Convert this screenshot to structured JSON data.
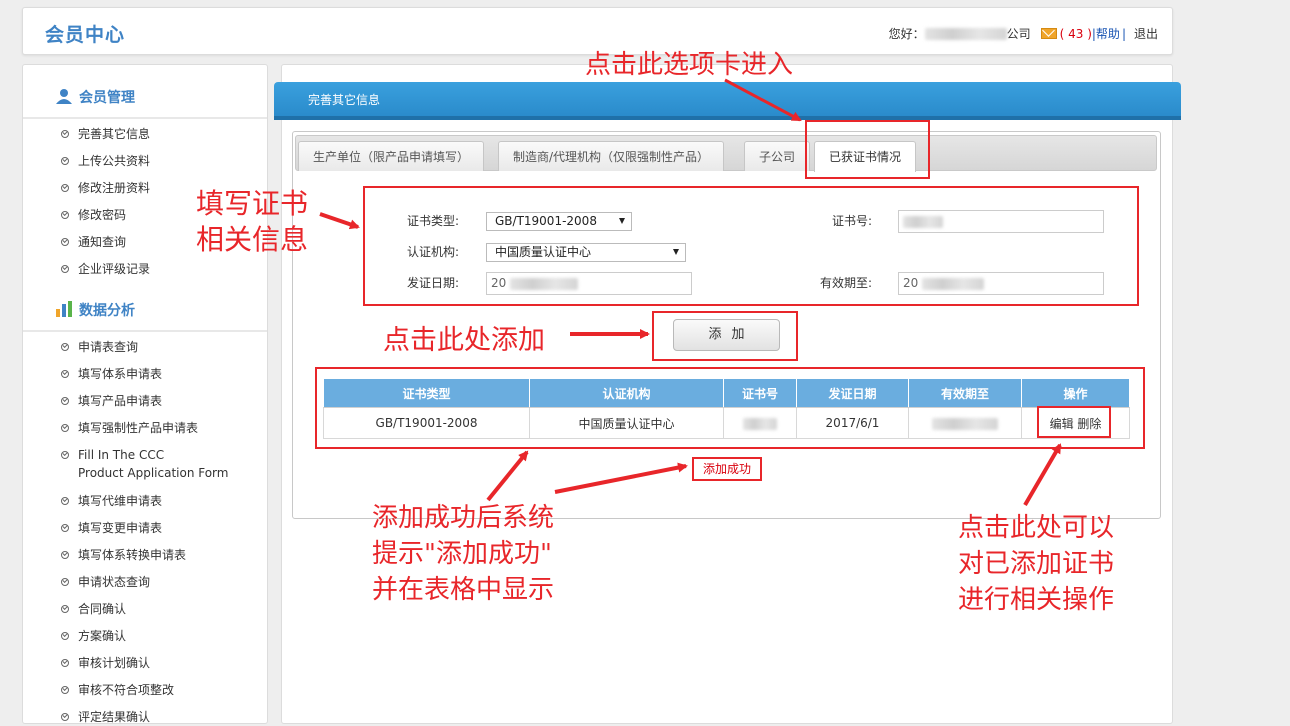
{
  "header": {
    "logo": "会员中心",
    "greeting": "您好：",
    "company_suffix": "公司",
    "mail_count": "( 43 )",
    "separator": "|",
    "help": "帮助",
    "logout": "退出"
  },
  "sidebar": {
    "section1": {
      "title": "会员管理",
      "items": [
        "完善其它信息",
        "上传公共资料",
        "修改注册资料",
        "修改密码",
        "通知查询",
        "企业评级记录"
      ]
    },
    "section2": {
      "title": "数据分析",
      "items": [
        "申请表查询",
        "填写体系申请表",
        "填写产品申请表",
        "填写强制性产品申请表",
        "Fill In The CCC",
        "Product Application Form",
        "填写代维申请表",
        "填写变更申请表",
        "填写体系转换申请表",
        "申请状态查询",
        "合同确认",
        "方案确认",
        "审核计划确认",
        "审核不符合项整改",
        "评定结果确认"
      ]
    }
  },
  "panel": {
    "title": "完善其它信息",
    "tabs": [
      "生产单位（限产品申请填写）",
      "制造商/代理机构（仅限强制性产品）",
      "子公司",
      "已获证书情况"
    ]
  },
  "form": {
    "cert_type_label": "证书类型:",
    "cert_type_value": "GB/T19001-2008",
    "cert_no_label": "证书号:",
    "agency_label": "认证机构:",
    "agency_value": "中国质量认证中心",
    "issue_date_label": "发证日期:",
    "issue_date_value": "20",
    "expiry_label": "有效期至:",
    "expiry_value": "20",
    "add_button": "添加"
  },
  "table": {
    "headers": [
      "证书类型",
      "认证机构",
      "证书号",
      "发证日期",
      "有效期至",
      "操作"
    ],
    "rows": [
      {
        "cert_type": "GB/T19001-2008",
        "agency": "中国质量认证中心",
        "issue_date": "2017/6/1",
        "edit": "编辑",
        "delete": "删除"
      }
    ]
  },
  "success_message": "添加成功",
  "annotations": {
    "tab_hint": "点击此选项卡进入",
    "fill_hint_1": "填写证书",
    "fill_hint_2": "相关信息",
    "add_hint": "点击此处添加",
    "success_hint_1": "添加成功后系统",
    "success_hint_2": "提示\"添加成功\"",
    "success_hint_3": "并在表格中显示",
    "op_hint_1": "点击此处可以",
    "op_hint_2": "对已添加证书",
    "op_hint_3": "进行相关操作"
  },
  "colors": {
    "brand": "#3f83c5",
    "ribbon": "#2a8bcb",
    "table_header": "#6aaddf",
    "annotation": "#e8262a"
  }
}
